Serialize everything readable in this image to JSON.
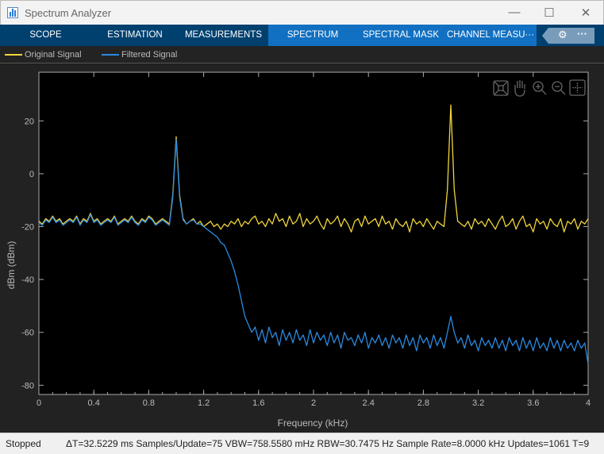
{
  "window": {
    "title": "Spectrum Analyzer",
    "icon": "spectrum-app-icon"
  },
  "tabs": [
    {
      "label": "SCOPE"
    },
    {
      "label": "ESTIMATION"
    },
    {
      "label": "MEASUREMENTS"
    },
    {
      "label": "SPECTRUM",
      "selected": true
    },
    {
      "label": "SPECTRAL MASK"
    },
    {
      "label": "CHANNEL MEASU···"
    }
  ],
  "colors": {
    "tab_dark": "#00406f",
    "tab_selected_group": "#1170c2",
    "original": "#f0d53c",
    "filtered": "#2b8ae0"
  },
  "plot_toolbar": [
    "autoscale-icon",
    "pan-hand-icon",
    "zoom-in-icon",
    "zoom-out-icon",
    "fit-axes-icon"
  ],
  "chart_data": {
    "type": "line",
    "xlabel": "Frequency (kHz)",
    "ylabel": "dBm (dBm)",
    "xlim": [
      0,
      4
    ],
    "ylim": [
      -83.5,
      38.4
    ],
    "xticks": [
      "0",
      "0.4",
      "0.8",
      "1.2",
      "1.6",
      "2",
      "2.4",
      "2.8",
      "3.2",
      "3.6",
      "4"
    ],
    "yticks": [
      "20",
      "0",
      "-20",
      "-40",
      "-60",
      "-80"
    ],
    "grid": false,
    "legend": "top-left",
    "x_start": 0,
    "x_step": 0.025,
    "series": [
      {
        "name": "Original Signal",
        "color": "#f0d53c",
        "values": [
          -18,
          -19,
          -17,
          -18,
          -16,
          -18,
          -17,
          -19,
          -18,
          -17,
          -18,
          -16,
          -19,
          -17,
          -18,
          -15,
          -18,
          -17,
          -19,
          -18,
          -17,
          -18,
          -16,
          -19,
          -18,
          -17,
          -18,
          -16,
          -18,
          -19,
          -17,
          -18,
          -16,
          -17,
          -19,
          -18,
          -17,
          -18,
          -19,
          -8,
          14,
          -8,
          -17,
          -19,
          -18,
          -17,
          -19,
          -18,
          -20,
          -19,
          -18,
          -20,
          -19,
          -21,
          -19,
          -20,
          -18,
          -19,
          -17,
          -20,
          -18,
          -19,
          -17,
          -16,
          -19,
          -18,
          -20,
          -17,
          -19,
          -15,
          -18,
          -17,
          -20,
          -16,
          -19,
          -18,
          -15,
          -20,
          -17,
          -19,
          -18,
          -16,
          -19,
          -21,
          -17,
          -19,
          -18,
          -16,
          -20,
          -17,
          -19,
          -22,
          -18,
          -17,
          -20,
          -16,
          -19,
          -18,
          -17,
          -20,
          -16,
          -19,
          -18,
          -21,
          -17,
          -19,
          -20,
          -18,
          -22,
          -17,
          -19,
          -18,
          -20,
          -17,
          -19,
          -21,
          -18,
          -19,
          -20,
          -6,
          26,
          -6,
          -18,
          -19,
          -20,
          -18,
          -21,
          -17,
          -19,
          -18,
          -20,
          -17,
          -19,
          -21,
          -18,
          -16,
          -20,
          -19,
          -17,
          -21,
          -18,
          -16,
          -20,
          -19,
          -22,
          -17,
          -19,
          -18,
          -21,
          -17,
          -19,
          -20,
          -17,
          -22,
          -18,
          -19,
          -17,
          -21,
          -18,
          -19,
          -17
        ]
      },
      {
        "name": "Filtered Signal",
        "color": "#2b8ae0",
        "values": [
          -18.5,
          -19.5,
          -17.5,
          -18.5,
          -16.5,
          -18.5,
          -17.5,
          -19.5,
          -18.5,
          -17.5,
          -18.5,
          -16.5,
          -19.5,
          -17.5,
          -18.5,
          -15.5,
          -18.5,
          -17.5,
          -19.5,
          -18.5,
          -17.5,
          -18.5,
          -16.5,
          -19.5,
          -18.5,
          -17.5,
          -18.5,
          -16.5,
          -18.5,
          -19.5,
          -17.5,
          -18.5,
          -16.5,
          -17.5,
          -19.5,
          -18.5,
          -17.5,
          -18.5,
          -19.5,
          -9,
          13,
          -9,
          -17.5,
          -19,
          -18,
          -17.5,
          -19,
          -19,
          -20,
          -21,
          -22,
          -23,
          -24,
          -26,
          -27,
          -30,
          -33,
          -37,
          -42,
          -48,
          -54,
          -57,
          -60,
          -58,
          -63,
          -59,
          -64,
          -58,
          -62,
          -60,
          -65,
          -59,
          -63,
          -60,
          -64,
          -59,
          -63,
          -61,
          -65,
          -59,
          -64,
          -60,
          -63,
          -61,
          -65,
          -60,
          -64,
          -61,
          -66,
          -60,
          -63,
          -62,
          -65,
          -61,
          -64,
          -60,
          -66,
          -62,
          -64,
          -61,
          -65,
          -62,
          -66,
          -61,
          -64,
          -62,
          -66,
          -61,
          -65,
          -62,
          -67,
          -61,
          -64,
          -62,
          -66,
          -61,
          -65,
          -62,
          -66,
          -60,
          -54,
          -60,
          -64,
          -62,
          -66,
          -61,
          -65,
          -63,
          -67,
          -62,
          -65,
          -63,
          -66,
          -62,
          -66,
          -63,
          -67,
          -62,
          -65,
          -63,
          -67,
          -62,
          -66,
          -63,
          -67,
          -62,
          -66,
          -64,
          -67,
          -62,
          -66,
          -63,
          -67,
          -63,
          -66,
          -64,
          -67,
          -63,
          -66,
          -64,
          -72
        ]
      }
    ]
  },
  "status": {
    "state": "Stopped",
    "info": "ΔT=32.5229 ms  Samples/Update=75  VBW=758.5580 mHz  RBW=30.7475 Hz  Sample Rate=8.0000 kHz  Updates=1061  T=9"
  }
}
